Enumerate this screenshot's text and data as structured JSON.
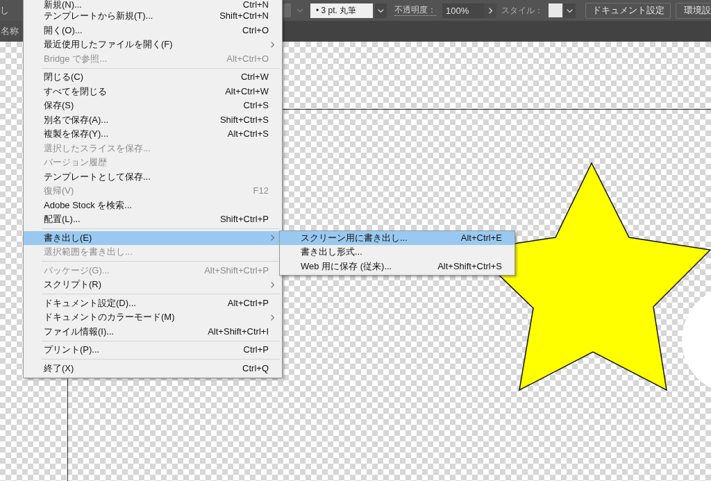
{
  "control_bar": {
    "cut_label": "し",
    "stroke": "• 3 pt. 丸筆",
    "opacity_label": "不透明度：",
    "opacity": "100%",
    "style_label": "スタイル：",
    "buttons": [
      "ドキュメント設定",
      "環境設"
    ]
  },
  "document_tab": {
    "title": "名称"
  },
  "menu": {
    "items": [
      {
        "kind": "item",
        "label": "新規(N)...",
        "shortcut": "Ctrl+N",
        "disabled": false,
        "selected": false,
        "has_submenu": false
      },
      {
        "kind": "item",
        "label": "テンプレートから新規(T)...",
        "shortcut": "Shift+Ctrl+N",
        "disabled": false,
        "selected": false,
        "has_submenu": false
      },
      {
        "kind": "item",
        "label": "開く(O)...",
        "shortcut": "Ctrl+O",
        "disabled": false,
        "selected": false,
        "has_submenu": false
      },
      {
        "kind": "item",
        "label": "最近使用したファイルを開く(F)",
        "disabled": false,
        "selected": false,
        "has_submenu": true
      },
      {
        "kind": "item",
        "label": "Bridge で参照...",
        "shortcut": "Alt+Ctrl+O",
        "disabled": true,
        "selected": false,
        "has_submenu": false
      },
      {
        "kind": "separator"
      },
      {
        "kind": "item",
        "label": "閉じる(C)",
        "shortcut": "Ctrl+W",
        "disabled": false,
        "selected": false,
        "has_submenu": false
      },
      {
        "kind": "item",
        "label": "すべてを閉じる",
        "shortcut": "Alt+Ctrl+W",
        "disabled": false,
        "selected": false,
        "has_submenu": false
      },
      {
        "kind": "item",
        "label": "保存(S)",
        "shortcut": "Ctrl+S",
        "disabled": false,
        "selected": false,
        "has_submenu": false
      },
      {
        "kind": "item",
        "label": "別名で保存(A)...",
        "shortcut": "Shift+Ctrl+S",
        "disabled": false,
        "selected": false,
        "has_submenu": false
      },
      {
        "kind": "item",
        "label": "複製を保存(Y)...",
        "shortcut": "Alt+Ctrl+S",
        "disabled": false,
        "selected": false,
        "has_submenu": false
      },
      {
        "kind": "item",
        "label": "選択したスライスを保存...",
        "disabled": true,
        "selected": false,
        "has_submenu": false
      },
      {
        "kind": "item",
        "label": "バージョン履歴",
        "disabled": true,
        "selected": false,
        "has_submenu": false
      },
      {
        "kind": "item",
        "label": "テンプレートとして保存...",
        "disabled": false,
        "selected": false,
        "has_submenu": false
      },
      {
        "kind": "item",
        "label": "復帰(V)",
        "shortcut": "F12",
        "disabled": true,
        "selected": false,
        "has_submenu": false
      },
      {
        "kind": "item",
        "label": "Adobe Stock を検索...",
        "disabled": false,
        "selected": false,
        "has_submenu": false
      },
      {
        "kind": "item",
        "label": "配置(L)...",
        "shortcut": "Shift+Ctrl+P",
        "disabled": false,
        "selected": false,
        "has_submenu": false
      },
      {
        "kind": "separator"
      },
      {
        "kind": "item",
        "label": "書き出し(E)",
        "disabled": false,
        "selected": true,
        "has_submenu": true,
        "children": [
          {
            "label": "スクリーン用に書き出し...",
            "shortcut": "Alt+Ctrl+E",
            "selected": true
          },
          {
            "label": "書き出し形式...",
            "selected": false
          },
          {
            "label": "Web 用に保存 (従来)...",
            "shortcut": "Alt+Shift+Ctrl+S",
            "selected": false
          }
        ]
      },
      {
        "kind": "item",
        "label": "選択範囲を書き出し...",
        "disabled": true,
        "selected": false,
        "has_submenu": false
      },
      {
        "kind": "separator"
      },
      {
        "kind": "item",
        "label": "パッケージ(G)...",
        "shortcut": "Alt+Shift+Ctrl+P",
        "disabled": true,
        "selected": false,
        "has_submenu": false
      },
      {
        "kind": "item",
        "label": "スクリプト(R)",
        "disabled": false,
        "selected": false,
        "has_submenu": true
      },
      {
        "kind": "separator"
      },
      {
        "kind": "item",
        "label": "ドキュメント設定(D)...",
        "shortcut": "Alt+Ctrl+P",
        "disabled": false,
        "selected": false,
        "has_submenu": false
      },
      {
        "kind": "item",
        "label": "ドキュメントのカラーモード(M)",
        "disabled": false,
        "selected": false,
        "has_submenu": true
      },
      {
        "kind": "item",
        "label": "ファイル情報(I)...",
        "shortcut": "Alt+Shift+Ctrl+I",
        "disabled": false,
        "selected": false,
        "has_submenu": false
      },
      {
        "kind": "separator"
      },
      {
        "kind": "item",
        "label": "プリント(P)...",
        "shortcut": "Ctrl+P",
        "disabled": false,
        "selected": false,
        "has_submenu": false
      },
      {
        "kind": "separator"
      },
      {
        "kind": "item",
        "label": "終了(X)",
        "shortcut": "Ctrl+Q",
        "disabled": false,
        "selected": false,
        "has_submenu": false
      }
    ]
  }
}
